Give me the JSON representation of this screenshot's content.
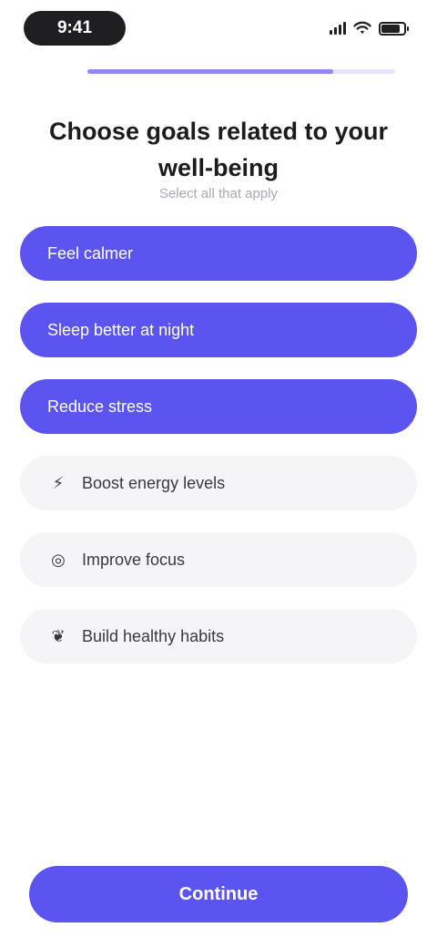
{
  "status_bar": {
    "time": "9:41"
  },
  "progress": {
    "fraction": 0.8
  },
  "title": "Choose goals related to your well-being",
  "subtitle": "Select all that apply",
  "options": [
    {
      "label": "Feel calmer",
      "selected": true,
      "icon": ""
    },
    {
      "label": "Sleep better at night",
      "selected": true,
      "icon": ""
    },
    {
      "label": "Reduce stress",
      "selected": true,
      "icon": ""
    },
    {
      "label": "Boost energy levels",
      "selected": false,
      "icon": "lightning-icon"
    },
    {
      "label": "Improve focus",
      "selected": false,
      "icon": "target-icon"
    },
    {
      "label": "Build healthy habits",
      "selected": false,
      "icon": "leaf-icon"
    }
  ],
  "continue_label": "Continue",
  "colors": {
    "accent": "#5b54ee",
    "progress": "#8f89f0",
    "option_bg": "#f5f5f8"
  }
}
